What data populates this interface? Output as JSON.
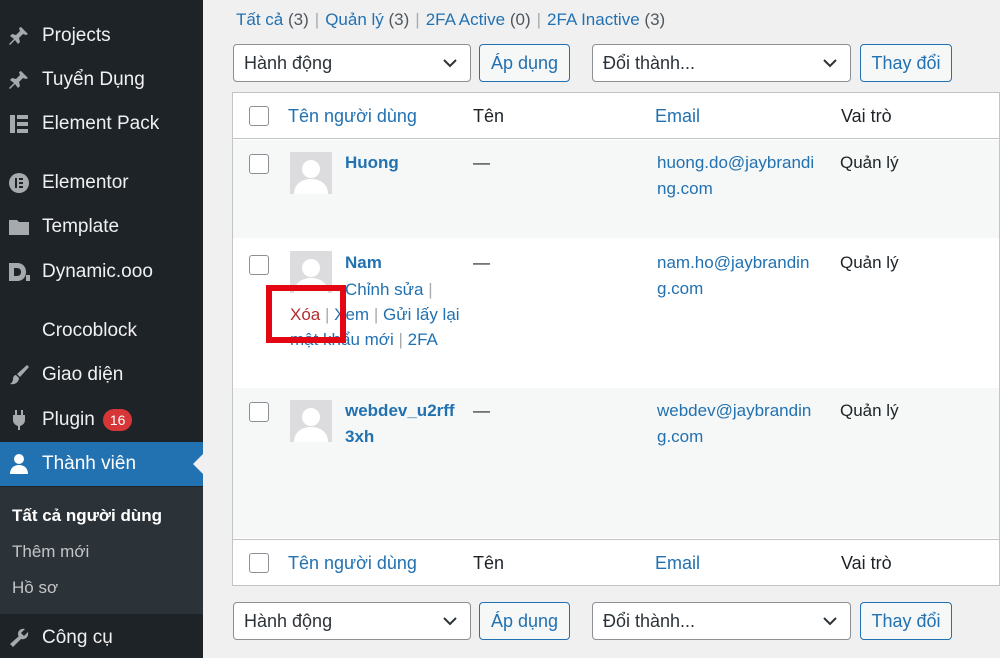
{
  "sidebar": {
    "items": [
      {
        "label": "Projects",
        "icon": "pin-icon"
      },
      {
        "label": "Tuyển Dụng",
        "icon": "pin-icon"
      },
      {
        "label": "Element Pack",
        "icon": "element-pack-icon"
      },
      {
        "label": "Elementor",
        "icon": "elementor-icon"
      },
      {
        "label": "Template",
        "icon": "folder-icon"
      },
      {
        "label": "Dynamic.ooo",
        "icon": "dynamic-icon"
      },
      {
        "label": "Crocoblock",
        "icon": ""
      },
      {
        "label": "Giao diện",
        "icon": "brush-icon"
      },
      {
        "label": "Plugin",
        "icon": "plugin-icon",
        "badge": "16"
      },
      {
        "label": "Thành viên",
        "icon": "user-icon"
      },
      {
        "label": "Công cụ",
        "icon": "wrench-icon"
      }
    ],
    "submenu": [
      "Tất cả người dùng",
      "Thêm mới",
      "Hồ sơ"
    ]
  },
  "filters": {
    "all": "Tất cả",
    "all_count": "(3)",
    "admin": "Quản lý",
    "admin_count": "(3)",
    "active": "2FA Active",
    "active_count": "(0)",
    "inactive": "2FA Inactive",
    "inactive_count": "(3)",
    "sep": "|"
  },
  "bulk": {
    "action_select": "Hành động",
    "apply": "Áp dụng",
    "role_select": "Đổi thành...",
    "change": "Thay đổi"
  },
  "columns": {
    "username": "Tên người dùng",
    "name": "Tên",
    "email": "Email",
    "role": "Vai trò"
  },
  "users": [
    {
      "username": "Huong",
      "name": "—",
      "email": "huong.do@jaybranding.com",
      "role": "Quản lý"
    },
    {
      "username": "Nam",
      "name": "—",
      "email": "nam.ho@jaybranding.com",
      "role": "Quản lý"
    },
    {
      "username": "webdev_u2rff3xh",
      "name": "—",
      "email": "webdev@jaybranding.com",
      "role": "Quản lý"
    }
  ],
  "row_actions": {
    "edit": "Chỉnh sửa",
    "delete": "Xóa",
    "view": "Xem",
    "reset": "Gửi lấy lại mật khẩu mới",
    "twofa": "2FA",
    "sep": "|"
  },
  "colors": {
    "sidebar_bg": "#1d2327",
    "accent": "#2271b1",
    "delete": "#b32d2e",
    "highlight": "#e30613"
  }
}
